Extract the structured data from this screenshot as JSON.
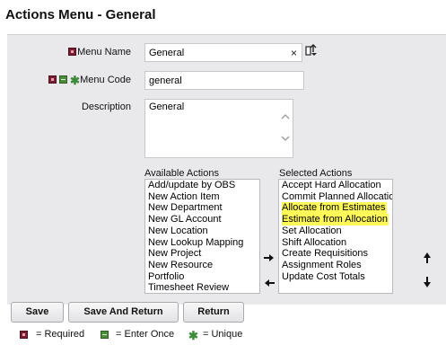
{
  "page": {
    "title": "Actions Menu - General"
  },
  "form": {
    "menu_name": {
      "label": "Menu Name",
      "value": "General",
      "clear_symbol": "×"
    },
    "menu_code": {
      "label": "Menu Code",
      "value": "general"
    },
    "description": {
      "label": "Description",
      "value": "General"
    }
  },
  "lists": {
    "available": {
      "caption": "Available Actions",
      "items": [
        "Add/update by OBS",
        "New Action Item",
        "New Department",
        "New GL Account",
        "New Location",
        "New Lookup Mapping",
        "New Project",
        "New Resource",
        "Portfolio",
        "Timesheet Review"
      ]
    },
    "selected": {
      "caption": "Selected Actions",
      "items": [
        "Accept Hard Allocation",
        "Commit Planned Allocation",
        "Allocate from Estimates",
        "Estimate from Allocation",
        "Set Allocation",
        "Shift Allocation",
        "Create Requisitions",
        "Assignment Roles",
        "Update Cost Totals"
      ],
      "highlighted": [
        "Allocate from Estimates",
        "Estimate from Allocation"
      ]
    }
  },
  "buttons": {
    "save": "Save",
    "save_and_return": "Save And Return",
    "return": "Return"
  },
  "legend": {
    "required": "= Required",
    "enter_once": "= Enter Once",
    "unique": "= Unique"
  },
  "icons": {
    "required": "required-icon",
    "enter_once": "enter-once-icon",
    "unique": "unique-asterisk-icon",
    "lookup": "browse-lookup-icon",
    "move_right": "move-right-arrow-icon",
    "move_left": "move-left-arrow-icon",
    "move_up": "move-up-arrow-icon",
    "move_down": "move-down-arrow-icon"
  },
  "colors": {
    "required": "#7a1f33",
    "enter_once": "#4e8a3e",
    "unique": "#3d8a3a",
    "highlight": "#fff95a",
    "panel": "#e9e9ec"
  }
}
